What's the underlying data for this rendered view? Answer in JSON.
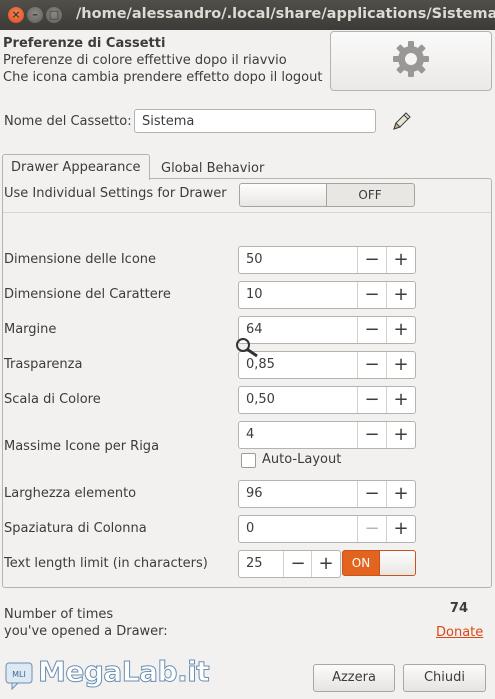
{
  "window": {
    "title": "/home/alessandro/.local/share/applications/Sistema.desktop"
  },
  "header": {
    "heading": "Preferenze di Cassetti",
    "line1": "Preferenze di colore effettive dopo il riavvio",
    "line2": "Che icona cambia prendere effetto dopo il logout",
    "icon": "gear-icon"
  },
  "name_row": {
    "label": "Nome del Cassetto:",
    "value": "Sistema"
  },
  "tabs": [
    {
      "label": "Drawer Appearance",
      "active": true
    },
    {
      "label": "Global  Behavior",
      "active": false
    }
  ],
  "individual": {
    "label": "Use Individual Settings for Drawer",
    "state": "OFF"
  },
  "settings": [
    {
      "label": "Dimensione delle Icone",
      "value": "50"
    },
    {
      "label": "Dimensione del Carattere",
      "value": "10"
    },
    {
      "label": "Margine",
      "value": "64"
    },
    {
      "label": "Trasparenza",
      "value": "0,85"
    },
    {
      "label": "Scala di Colore",
      "value": "0,50"
    },
    {
      "label": "Massime Icone per Riga",
      "value": "4"
    },
    {
      "label": "Larghezza elemento",
      "value": "96"
    },
    {
      "label": "Spaziatura di Colonna",
      "value": "0"
    }
  ],
  "spin_minus": "−",
  "spin_plus": "+",
  "auto_layout": {
    "label": "Auto-Layout",
    "checked": false
  },
  "text_limit": {
    "label": "Text length limit (in characters)",
    "value": "25",
    "state": "ON"
  },
  "footer": {
    "count_label_1": "Number of times",
    "count_label_2": "you've opened a Drawer:",
    "count": "74",
    "donate": "Donate",
    "reset": "Azzera",
    "close": "Chiudi"
  },
  "watermark": {
    "text": "MegaLab.it",
    "badge": "MLI"
  },
  "colors": {
    "accent": "#dd4814",
    "switch_on": "#e2641f"
  }
}
